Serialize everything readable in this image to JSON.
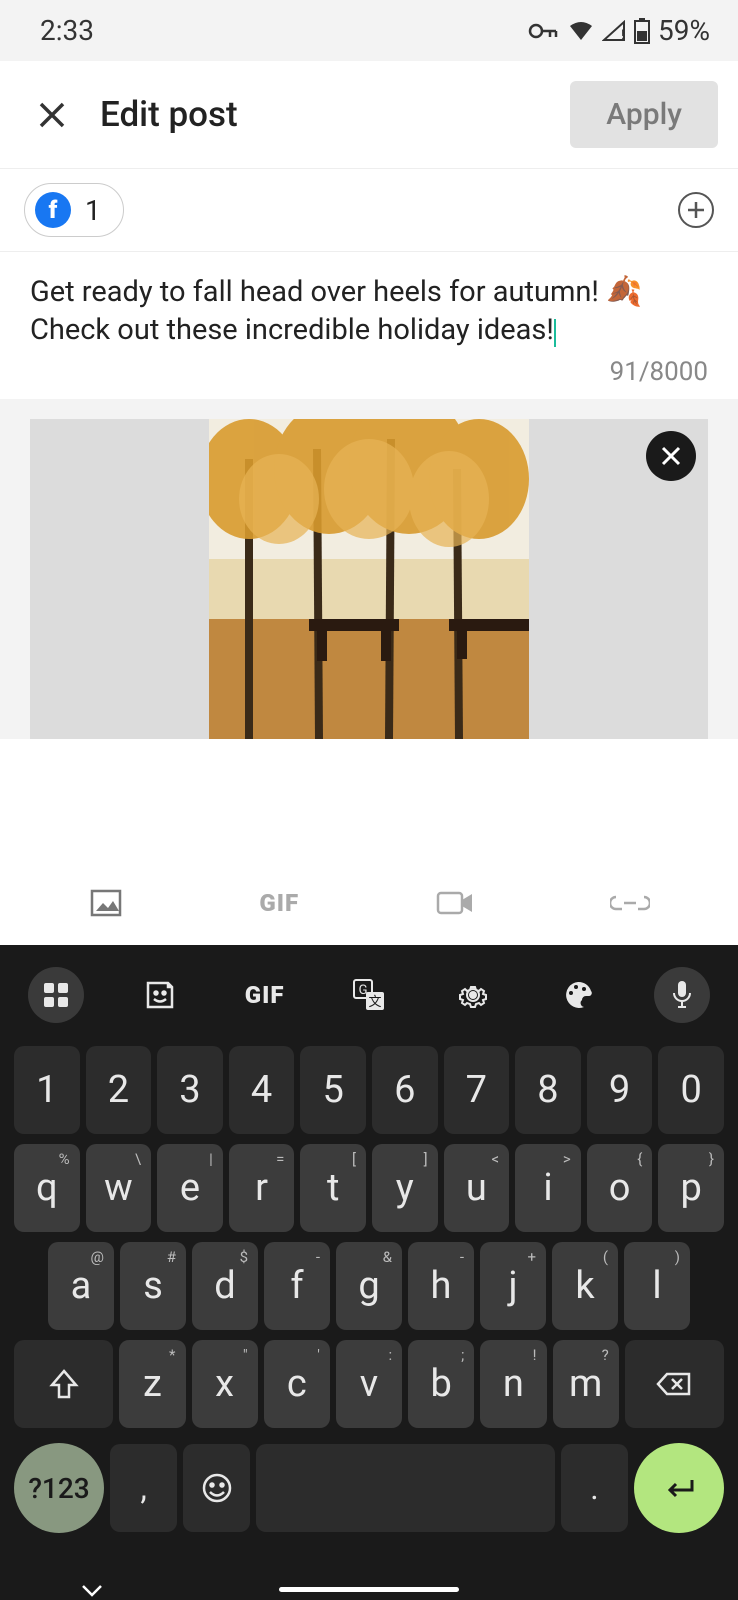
{
  "status": {
    "time": "2:33",
    "battery": "59%"
  },
  "header": {
    "title": "Edit post",
    "apply": "Apply"
  },
  "account": {
    "count": "1"
  },
  "post": {
    "text_before": "Get ready to fall head over heels for autumn!  🍂 Check out these incredible holiday ideas!",
    "char_count": "91/8000"
  },
  "attach": {
    "gif": "GIF"
  },
  "keyboard": {
    "gif": "GIF",
    "row1": [
      "1",
      "2",
      "3",
      "4",
      "5",
      "6",
      "7",
      "8",
      "9",
      "0"
    ],
    "row2": [
      {
        "k": "q",
        "h": "%"
      },
      {
        "k": "w",
        "h": "\\"
      },
      {
        "k": "e",
        "h": "|"
      },
      {
        "k": "r",
        "h": "="
      },
      {
        "k": "t",
        "h": "["
      },
      {
        "k": "y",
        "h": "]"
      },
      {
        "k": "u",
        "h": "<"
      },
      {
        "k": "i",
        "h": ">"
      },
      {
        "k": "o",
        "h": "{"
      },
      {
        "k": "p",
        "h": "}"
      }
    ],
    "row3": [
      {
        "k": "a",
        "h": "@"
      },
      {
        "k": "s",
        "h": "#"
      },
      {
        "k": "d",
        "h": "$"
      },
      {
        "k": "f",
        "h": "-"
      },
      {
        "k": "g",
        "h": "&"
      },
      {
        "k": "h",
        "h": "-"
      },
      {
        "k": "j",
        "h": "+"
      },
      {
        "k": "k",
        "h": "("
      },
      {
        "k": "l",
        "h": ")"
      }
    ],
    "row4": [
      {
        "k": "z",
        "h": "*"
      },
      {
        "k": "x",
        "h": "\""
      },
      {
        "k": "c",
        "h": "'"
      },
      {
        "k": "v",
        "h": ":"
      },
      {
        "k": "b",
        "h": ";"
      },
      {
        "k": "n",
        "h": "!"
      },
      {
        "k": "m",
        "h": "?"
      }
    ],
    "sym": "?123",
    "comma": ",",
    "period": "."
  }
}
